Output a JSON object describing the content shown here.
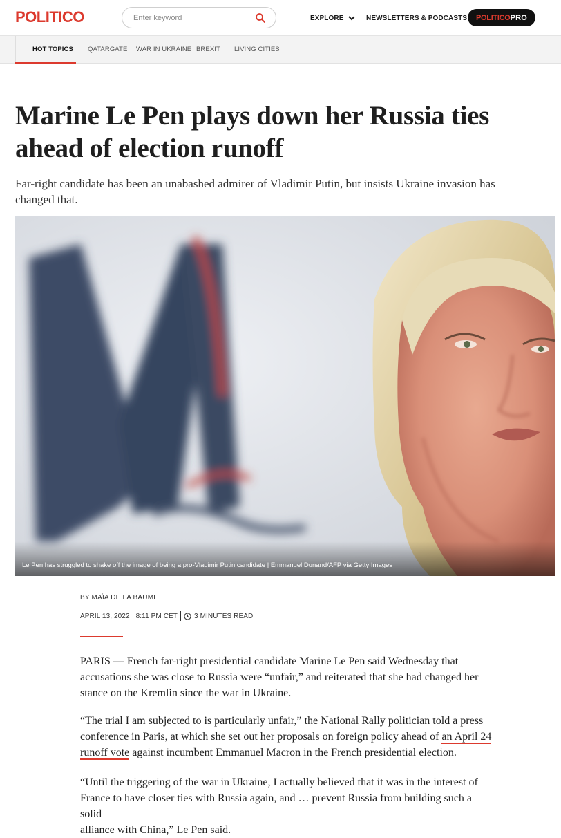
{
  "header": {
    "logo": "POLITICO",
    "search": {
      "placeholder": "Enter keyword"
    },
    "nav": [
      {
        "label": "EXPLORE"
      },
      {
        "label": "NEWSLETTERS & PODCASTS"
      }
    ],
    "pro": {
      "part1": "POLITICO",
      "part2": "PRO"
    }
  },
  "topics": {
    "items": [
      "HOT TOPICS",
      "QATARGATE",
      "WAR IN UKRAINE",
      "BREXIT",
      "LIVING CITIES"
    ]
  },
  "article": {
    "headline_line1": "Marine Le Pen plays down her Russia ties",
    "headline_line2": "ahead of election runoff",
    "dek_line1": "Far-right candidate has been an unabashed admirer of Vladimir Putin, but insists Ukraine invasion has",
    "dek_line2": "changed that.",
    "image_caption": "Le Pen has struggled to shake off the image of being a pro-Vladimir Putin candidate | Emmanuel Dunand/AFP via Getty Images",
    "byline_prefix": "BY",
    "author": "MAÏA DE LA BAUME",
    "date": "APRIL 13, 2022",
    "time": "8:11 PM CET",
    "read_time": "3 MINUTES READ",
    "p1": {
      "line1": "PARIS — French far-right presidential candidate Marine Le Pen said Wednesday that",
      "line2": "accusations she was close to Russia were “unfair,” and reiterated that she had changed her",
      "line3": "stance on the Kremlin since the war in Ukraine."
    },
    "p2": {
      "line1": "“The trial I am subjected to is particularly unfair,” the National Rally politician told a press",
      "line2": "conference in Paris, at which she set out her proposals on foreign policy ahead of ",
      "link_part1": "an April 24",
      "link_part2": "runoff vote",
      "line3_rest": " against incumbent Emmanuel Macron in the French presidential election."
    },
    "p3": {
      "line1": "“Until the triggering of the war in Ukraine, I actually believed that it was in the interest of",
      "line2": "France to have closer ties with Russia again, and … prevent Russia from building such a solid",
      "line3": "alliance with China,” Le Pen said."
    }
  },
  "colors": {
    "brand_red": "#dc3a2e",
    "pro_bg": "#111111",
    "topics_bg": "#f3f3f3"
  }
}
